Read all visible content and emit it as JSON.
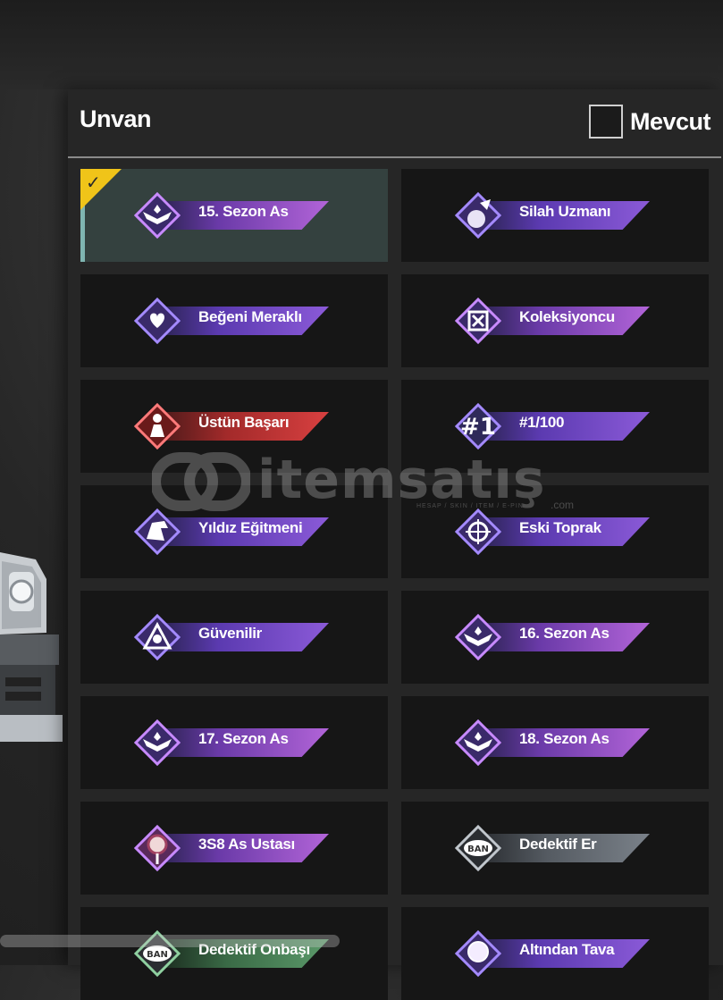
{
  "header": {
    "title": "Unvan",
    "filter_label": "Mevcut",
    "filter_checked": false
  },
  "selected_index": 0,
  "titles": [
    {
      "label": "15. Sezon As",
      "style": "pink",
      "icon": "season-ace-emblem-icon",
      "selected": true
    },
    {
      "label": "Silah Uzmanı",
      "style": "purple",
      "icon": "weapon-expert-emblem-icon",
      "selected": false
    },
    {
      "label": "Beğeni Meraklı",
      "style": "purple",
      "icon": "hearts-emblem-icon",
      "selected": false
    },
    {
      "label": "Koleksiyoncu",
      "style": "pink",
      "icon": "collector-emblem-icon",
      "selected": false
    },
    {
      "label": "Üstün Başarı",
      "style": "red",
      "icon": "achievement-emblem-icon",
      "selected": false
    },
    {
      "label": "#1/100",
      "style": "purple",
      "icon": "number-one-emblem-icon",
      "emblem_text": "#1",
      "selected": false
    },
    {
      "label": "Yıldız Eğitmeni",
      "style": "purple",
      "icon": "eagle-emblem-icon",
      "selected": false
    },
    {
      "label": "Eski Toprak",
      "style": "purple",
      "icon": "crosshair-emblem-icon",
      "selected": false
    },
    {
      "label": "Güvenilir",
      "style": "purple",
      "icon": "trusted-emblem-icon",
      "selected": false
    },
    {
      "label": "16. Sezon As",
      "style": "pink",
      "icon": "season-ace-emblem-icon",
      "selected": false
    },
    {
      "label": "17. Sezon As",
      "style": "pink",
      "icon": "season-ace-emblem-icon",
      "selected": false
    },
    {
      "label": "18. Sezon As",
      "style": "pink",
      "icon": "season-ace-emblem-icon",
      "selected": false
    },
    {
      "label": "3S8 As Ustası",
      "style": "pink",
      "icon": "target-emblem-icon",
      "selected": false
    },
    {
      "label": "Dedektif Er",
      "style": "grey",
      "icon": "detective-badge-emblem-icon",
      "emblem_text": "BAN",
      "selected": false
    },
    {
      "label": "Dedektif Onbaşı",
      "style": "green",
      "icon": "detective-badge-emblem-icon",
      "emblem_text": "BAN",
      "selected": false
    },
    {
      "label": "Altından Tava",
      "style": "purple",
      "icon": "golden-pan-emblem-icon",
      "selected": false
    }
  ],
  "watermark": {
    "brand": "itemsatış",
    "tagline": "HESAP / SKIN / ITEM / E-PIN",
    "suffix": ".com"
  },
  "colors": {
    "selected_cell": "#34413f",
    "check_corner": "#f0c419",
    "cell_bg": "#161616"
  }
}
